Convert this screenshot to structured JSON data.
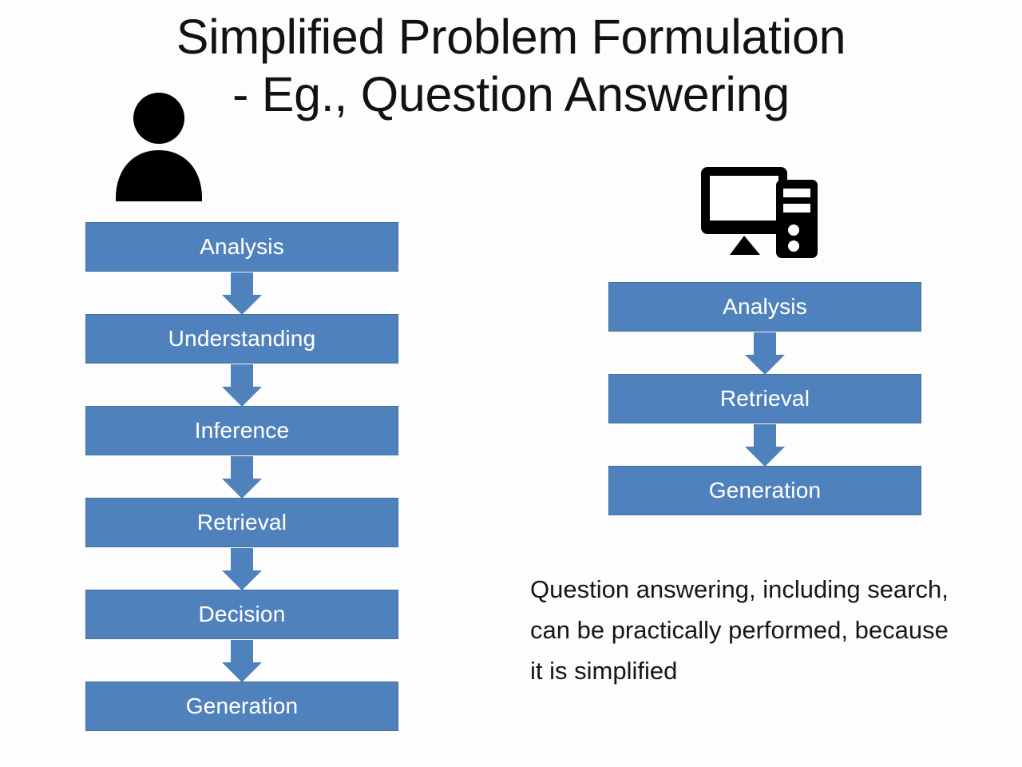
{
  "slide": {
    "background_color": "#fdfdfd",
    "title": {
      "line1": "Simplified Problem Formulation",
      "line2": "- Eg., Question Answering"
    },
    "icons": {
      "human": "person-icon",
      "machine": "computer-icon"
    },
    "accent_color": "#4f81bd",
    "box_border_color": "#41719c",
    "box_text_color": "#ffffff",
    "title_text_color": "#121212"
  },
  "flows": {
    "human": {
      "name": "human-problem-formulation",
      "steps": [
        {
          "label": "Analysis"
        },
        {
          "label": "Understanding"
        },
        {
          "label": "Inference"
        },
        {
          "label": "Retrieval"
        },
        {
          "label": "Decision"
        },
        {
          "label": "Generation"
        }
      ]
    },
    "machine": {
      "name": "simplified-problem-formulation",
      "steps": [
        {
          "label": "Analysis"
        },
        {
          "label": "Retrieval"
        },
        {
          "label": "Generation"
        }
      ]
    }
  },
  "caption": {
    "text": "Question answering, including search, can be practically performed, because it is simplified"
  }
}
